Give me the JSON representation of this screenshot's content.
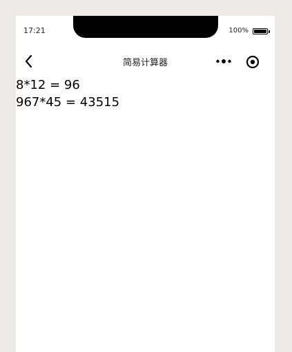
{
  "status_bar": {
    "time": "17:21",
    "battery_text": "100%"
  },
  "nav_bar": {
    "title": "简易计算器",
    "back_icon": "chevron-left-icon",
    "more_icon": "more-dots-icon",
    "close_icon": "target-close-icon"
  },
  "content": {
    "lines": [
      "8*12 = 96",
      "967*45 = 43515"
    ]
  }
}
